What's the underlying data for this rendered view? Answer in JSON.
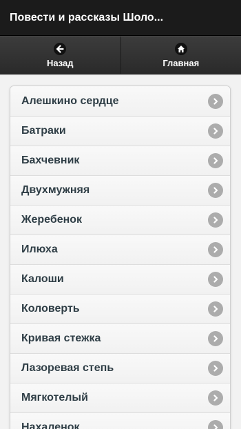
{
  "header": {
    "title": "Повести и рассказы Шоло..."
  },
  "nav": {
    "back_label": "Назад",
    "home_label": "Главная",
    "back_icon": "arrow-left-icon",
    "home_icon": "home-icon"
  },
  "list": {
    "items": [
      {
        "label": "Алешкино сердце"
      },
      {
        "label": "Батраки"
      },
      {
        "label": "Бахчевник"
      },
      {
        "label": "Двухмужняя"
      },
      {
        "label": "Жеребенок"
      },
      {
        "label": "Илюха"
      },
      {
        "label": "Калоши"
      },
      {
        "label": "Коловерть"
      },
      {
        "label": "Кривая стежка"
      },
      {
        "label": "Лазоревая степь"
      },
      {
        "label": "Мягкотелый"
      },
      {
        "label": "Нахаленок"
      }
    ]
  },
  "colors": {
    "header_bg": "#1b1b1b",
    "navbar_bg": "#333333",
    "chevron_bg": "#acacac",
    "item_text": "#2f3e46"
  }
}
